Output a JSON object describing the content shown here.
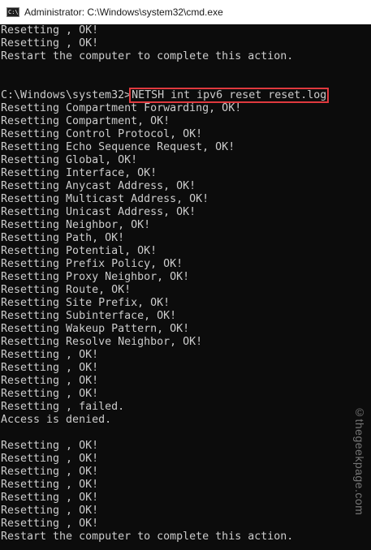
{
  "window": {
    "title": "Administrator: C:\\Windows\\system32\\cmd.exe",
    "icon_label": "C:\\"
  },
  "console": {
    "lines_before": [
      "Resetting , OK!",
      "Resetting , OK!",
      "Restart the computer to complete this action.",
      "",
      ""
    ],
    "prompt": "C:\\Windows\\system32>",
    "command": "NETSH int ipv6 reset reset.log",
    "lines_after": [
      "Resetting Compartment Forwarding, OK!",
      "Resetting Compartment, OK!",
      "Resetting Control Protocol, OK!",
      "Resetting Echo Sequence Request, OK!",
      "Resetting Global, OK!",
      "Resetting Interface, OK!",
      "Resetting Anycast Address, OK!",
      "Resetting Multicast Address, OK!",
      "Resetting Unicast Address, OK!",
      "Resetting Neighbor, OK!",
      "Resetting Path, OK!",
      "Resetting Potential, OK!",
      "Resetting Prefix Policy, OK!",
      "Resetting Proxy Neighbor, OK!",
      "Resetting Route, OK!",
      "Resetting Site Prefix, OK!",
      "Resetting Subinterface, OK!",
      "Resetting Wakeup Pattern, OK!",
      "Resetting Resolve Neighbor, OK!",
      "Resetting , OK!",
      "Resetting , OK!",
      "Resetting , OK!",
      "Resetting , OK!",
      "Resetting , failed.",
      "Access is denied.",
      "",
      "Resetting , OK!",
      "Resetting , OK!",
      "Resetting , OK!",
      "Resetting , OK!",
      "Resetting , OK!",
      "Resetting , OK!",
      "Resetting , OK!",
      "Restart the computer to complete this action."
    ]
  },
  "watermark": "©thegeekpage.com",
  "colors": {
    "background": "#0c0c0c",
    "text": "#cccccc",
    "highlight_border": "#e0393e",
    "titlebar": "#ffffff"
  }
}
